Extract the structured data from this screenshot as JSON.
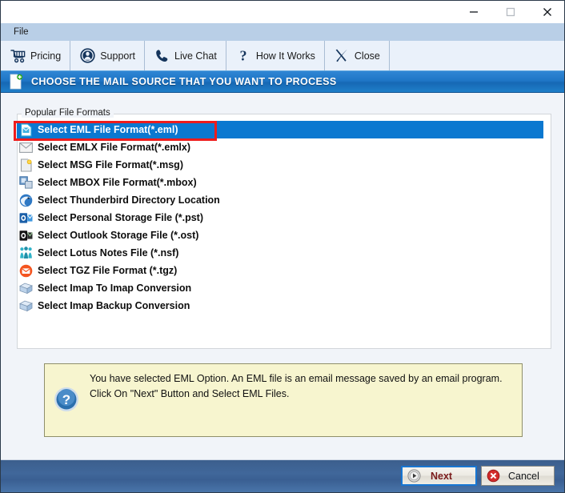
{
  "window": {
    "controls": [
      {
        "name": "minimize",
        "glyph": "minimize-icon"
      },
      {
        "name": "maximize",
        "glyph": "maximize-icon"
      },
      {
        "name": "close",
        "glyph": "close-icon"
      }
    ]
  },
  "menubar": {
    "items": [
      {
        "label": "File",
        "name": "menu-file"
      }
    ]
  },
  "toolbar": {
    "items": [
      {
        "label": "Pricing",
        "icon": "shopping-cart-icon"
      },
      {
        "label": "Support",
        "icon": "user-circle-icon"
      },
      {
        "label": "Live Chat",
        "icon": "phone-icon"
      },
      {
        "label": "How It Works",
        "icon": "question-mark-icon"
      },
      {
        "label": "Close",
        "icon": "x-mark-icon"
      }
    ]
  },
  "banner": {
    "title": "CHOOSE THE MAIL SOURCE THAT YOU WANT TO PROCESS",
    "icon": "document-add-icon",
    "color": "#1f76c6"
  },
  "list": {
    "group_label": "Popular File Formats",
    "selected_index": 0,
    "highlight_color": "#0b78d0",
    "annotation_color": "#ee1c1c",
    "items": [
      {
        "label": "Select EML File Format(*.eml)",
        "icon": "eml-file-icon"
      },
      {
        "label": "Select EMLX File Format(*.emlx)",
        "icon": "envelope-icon"
      },
      {
        "label": "Select MSG File Format(*.msg)",
        "icon": "msg-file-icon"
      },
      {
        "label": "Select MBOX File Format(*.mbox)",
        "icon": "mbox-icon"
      },
      {
        "label": "Select Thunderbird Directory Location",
        "icon": "thunderbird-icon"
      },
      {
        "label": "Select Personal Storage File (*.pst)",
        "icon": "outlook-pst-icon"
      },
      {
        "label": "Select Outlook Storage File (*.ost)",
        "icon": "outlook-ost-icon"
      },
      {
        "label": "Select Lotus Notes File (*.nsf)",
        "icon": "lotus-notes-icon"
      },
      {
        "label": "Select TGZ File Format (*.tgz)",
        "icon": "tgz-mail-icon"
      },
      {
        "label": "Select Imap To Imap Conversion",
        "icon": "imap-box-icon"
      },
      {
        "label": "Select Imap Backup Conversion",
        "icon": "imap-box-icon"
      }
    ]
  },
  "info": {
    "icon": "help-question-icon",
    "text": "You have selected EML Option. An EML file is an email message saved by an email program. Click On \"Next\" Button and Select EML Files.",
    "background": "#f7f5cf"
  },
  "footer": {
    "next_label": "Next",
    "next_icon": "play-circle-icon",
    "cancel_label": "Cancel",
    "cancel_icon": "cancel-x-icon"
  }
}
